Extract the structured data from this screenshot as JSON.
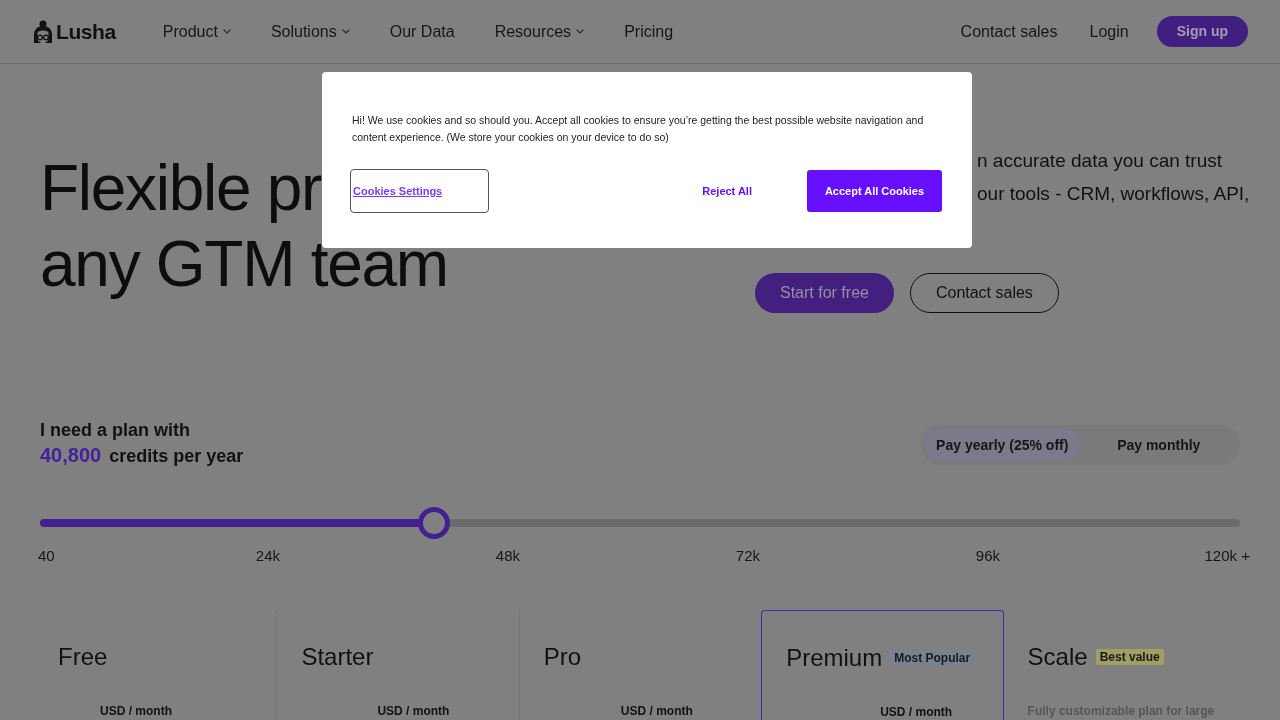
{
  "header": {
    "logo": "Lusha",
    "nav": [
      {
        "label": "Product",
        "has_menu": true
      },
      {
        "label": "Solutions",
        "has_menu": true
      },
      {
        "label": "Our Data",
        "has_menu": false
      },
      {
        "label": "Resources",
        "has_menu": true
      },
      {
        "label": "Pricing",
        "has_menu": false
      }
    ],
    "actions": [
      {
        "label": "Contact sales",
        "kind": "link"
      },
      {
        "label": "Login",
        "kind": "link"
      },
      {
        "label": "Sign up",
        "kind": "button"
      }
    ]
  },
  "hero": {
    "heading_lines": [
      "Flexible pr",
      "any GTM team"
    ],
    "text_lines": [
      "n accurate data you can trust",
      "our tools - CRM, workflows, API,"
    ],
    "buttons": [
      {
        "label": "Start for free",
        "kind": "primary"
      },
      {
        "label": "Contact sales",
        "kind": "outline"
      }
    ]
  },
  "credits": {
    "label": "I need a plan with",
    "amount": "40,800",
    "unit": "credits per year"
  },
  "billing_toggle": [
    {
      "label": "Pay yearly (25% off)",
      "selected": true
    },
    {
      "label": "Pay monthly",
      "selected": false
    }
  ],
  "slider": {
    "level": 0.328,
    "ticks": [
      "40",
      "24k",
      "48k",
      "72k",
      "96k",
      "120k +"
    ]
  },
  "plans": [
    {
      "name": "Free",
      "highlighted": false,
      "price_unit": "USD / month"
    },
    {
      "name": "Starter",
      "highlighted": false,
      "price_unit": "USD / month"
    },
    {
      "name": "Pro",
      "highlighted": false,
      "price_unit": "USD / month"
    },
    {
      "name": "Premium",
      "highlighted": true,
      "badge": {
        "label": "Most Popular",
        "color": "#76838f"
      },
      "price_unit": "USD / month"
    },
    {
      "name": "Scale",
      "highlighted": false,
      "badge": {
        "label": "Best value",
        "color": "#a0a062"
      },
      "description": "Fully customizable plan for large"
    }
  ],
  "cookie_banner": {
    "text": "Hi! We use cookies and so should you. Accept all cookies to ensure you’re getting the best possible website navigation and content experience. (We store your cookies on your device to do so)",
    "buttons": [
      {
        "label": "Cookies Settings",
        "kind": "settings"
      },
      {
        "label": "Reject All",
        "kind": "reject"
      },
      {
        "label": "Accept All Cookies",
        "kind": "accept"
      }
    ]
  }
}
